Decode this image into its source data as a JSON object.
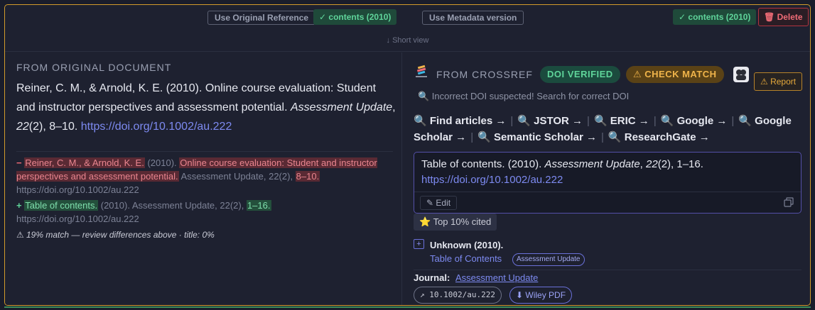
{
  "topbar": {
    "use_original_label": "Use Original Reference",
    "badge_left": "✓ contents (2010)",
    "use_metadata_label": "Use Metadata version",
    "badge_right": "✓ contents (2010)",
    "delete_label": "🗑 Delete"
  },
  "short_view": "↓ Short view",
  "left": {
    "title": "FROM ORIGINAL DOCUMENT",
    "reference": {
      "authors_year": "Reiner, C. M., & Arnold, K. E. (2010). Online course evaluation: Student and instructor perspectives and assessment potential. ",
      "journal": "Assessment Update",
      "sep1": ", ",
      "volume": "22",
      "issue_pages": "(2), 8–10. ",
      "doi_url": "https://doi.org/10.1002/au.222"
    },
    "diff_removed": {
      "marker": "−",
      "authors": "Reiner, C. M., & Arnold, K. E.",
      "year": " (2010). ",
      "title": "Online course evaluation: Student and instructor perspectives and assessment potential.",
      "journal": " Assessment Update, 22(2), ",
      "pages": "8–10.",
      "url": "https://doi.org/10.1002/au.222"
    },
    "diff_added": {
      "marker": "+",
      "title": "Table of contents.",
      "rest": " (2010). Assessment Update, 22(2), ",
      "pages": "1–16.",
      "url": "https://doi.org/10.1002/au.222"
    },
    "match_note": "⚠ 19% match — review differences above · title: 0%"
  },
  "right": {
    "title": "FROM CROSSREF",
    "doi_verified": "DOI VERIFIED",
    "check_match": "⚠ CHECK MATCH",
    "report_label": "⚠ Report",
    "incorrect_search": "🔍 Incorrect DOI suspected! Search for correct DOI",
    "search_links": [
      "🔍 Find articles →",
      "🔍 JSTOR →",
      "🔍 ERIC →",
      "🔍 Google →",
      "🔍 Google Scholar →",
      "🔍 Semantic Scholar →",
      "🔍 ResearchGate →"
    ],
    "card": {
      "text_start": "Table of contents. (2010). ",
      "journal": "Assessment Update",
      "sep": ", ",
      "volume": "22",
      "issue_pages": "(2), 1–16.",
      "doi_url": "https://doi.org/10.1002/au.222",
      "edit_label": "✎ Edit"
    },
    "top_cited": "⭐ Top 10% cited",
    "plus_label": "+",
    "unknown": "Unknown (2010).",
    "toc_link": "Table of Contents",
    "tag": "Assessment Update",
    "journal_label": "Journal:",
    "journal_link": "Assessment Update",
    "doi_chip": "↗ 10.1002/au.222",
    "pdf_chip": "⬇ Wiley PDF"
  },
  "colors": {
    "frame_border": "#d39b2a",
    "accent": "#7d8af0",
    "success": "#5fd49a",
    "danger": "#ef6b76",
    "warning": "#f0b44a"
  }
}
